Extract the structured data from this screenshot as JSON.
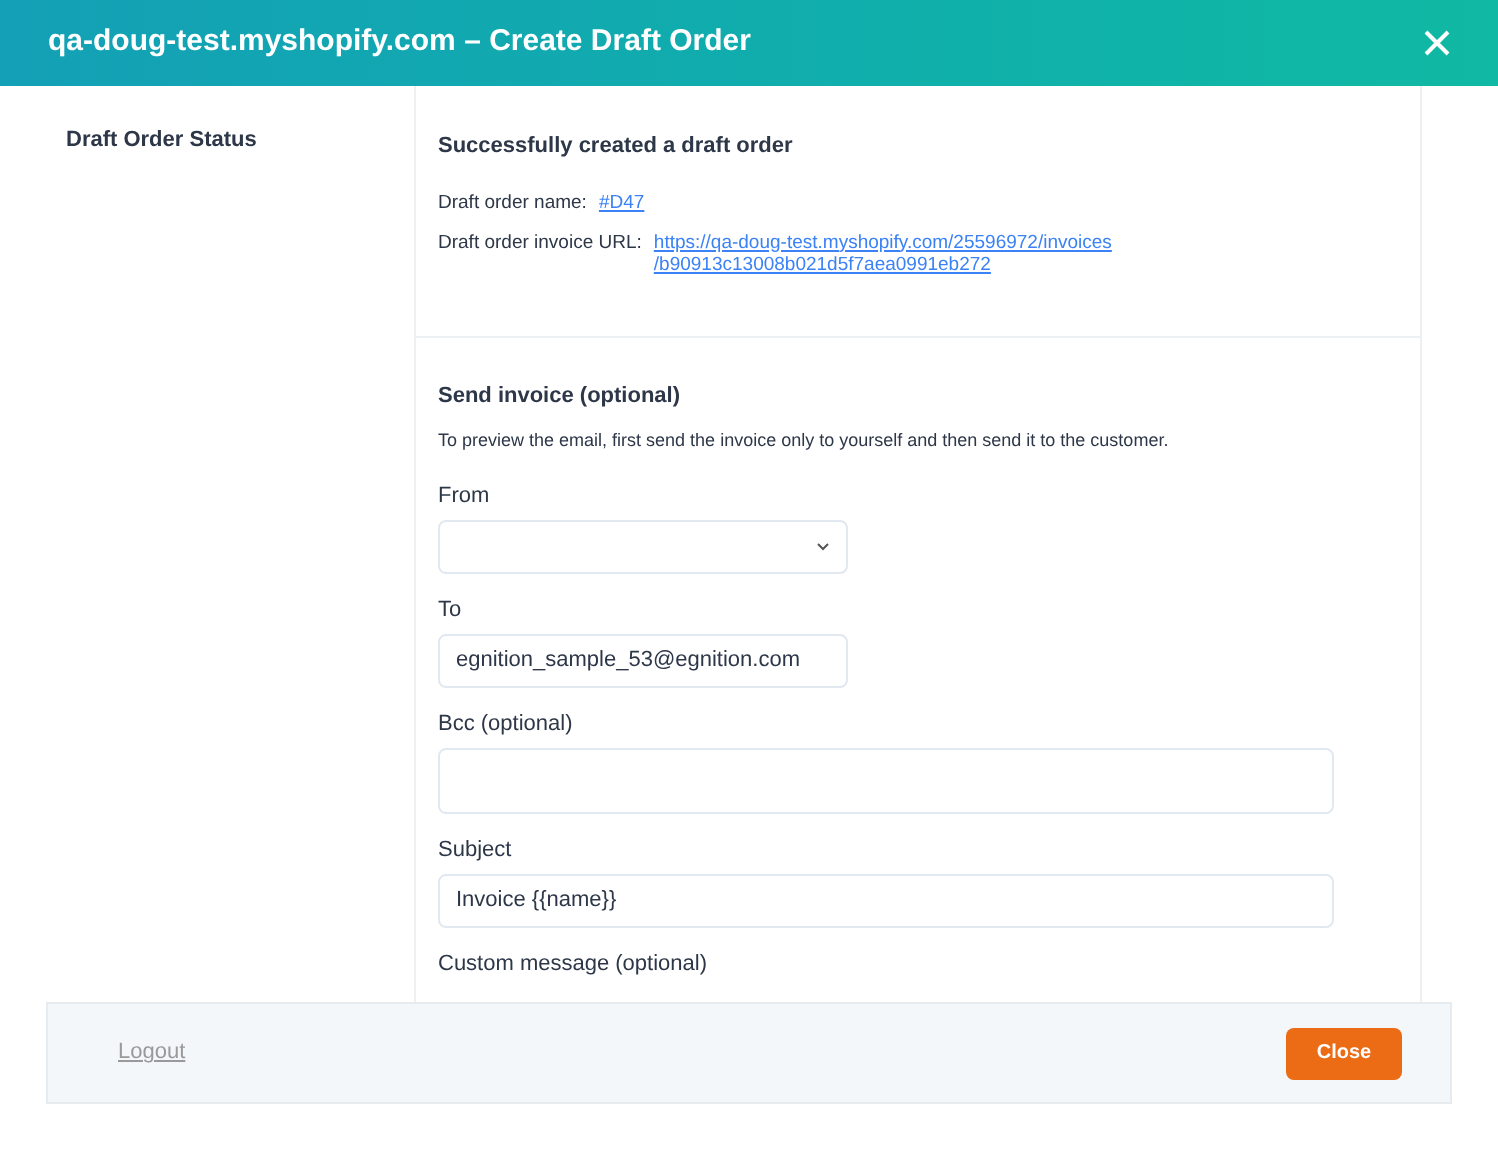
{
  "window": {
    "title": "qa-doug-test.myshopify.com – Create Draft Order"
  },
  "sidebar": {
    "label": "Draft Order Status"
  },
  "status": {
    "heading": "Successfully created a draft order",
    "rows": [
      {
        "label": "Draft order name:",
        "links": [
          "#D47"
        ]
      },
      {
        "label": "Draft order invoice URL:",
        "links": [
          "https://qa-doug-test.myshopify.com/25596972/invoices",
          "/b90913c13008b021d5f7aea0991eb272"
        ]
      }
    ]
  },
  "send_invoice": {
    "heading": "Send invoice (optional)",
    "description": "To preview the email, first send the invoice only to yourself and then send it to the customer.",
    "fields": [
      {
        "kind": "select",
        "label": "From"
      },
      {
        "kind": "input",
        "label": "To",
        "value": "egnition_sample_53@egnition.com"
      },
      {
        "kind": "input",
        "label": "Bcc (optional)"
      },
      {
        "kind": "input",
        "label": "Subject",
        "value": "Invoice {{name}}"
      },
      {
        "kind": "label",
        "label": "Custom message (optional)"
      }
    ]
  },
  "footer": {
    "logout": "Logout",
    "close": "Close"
  }
}
